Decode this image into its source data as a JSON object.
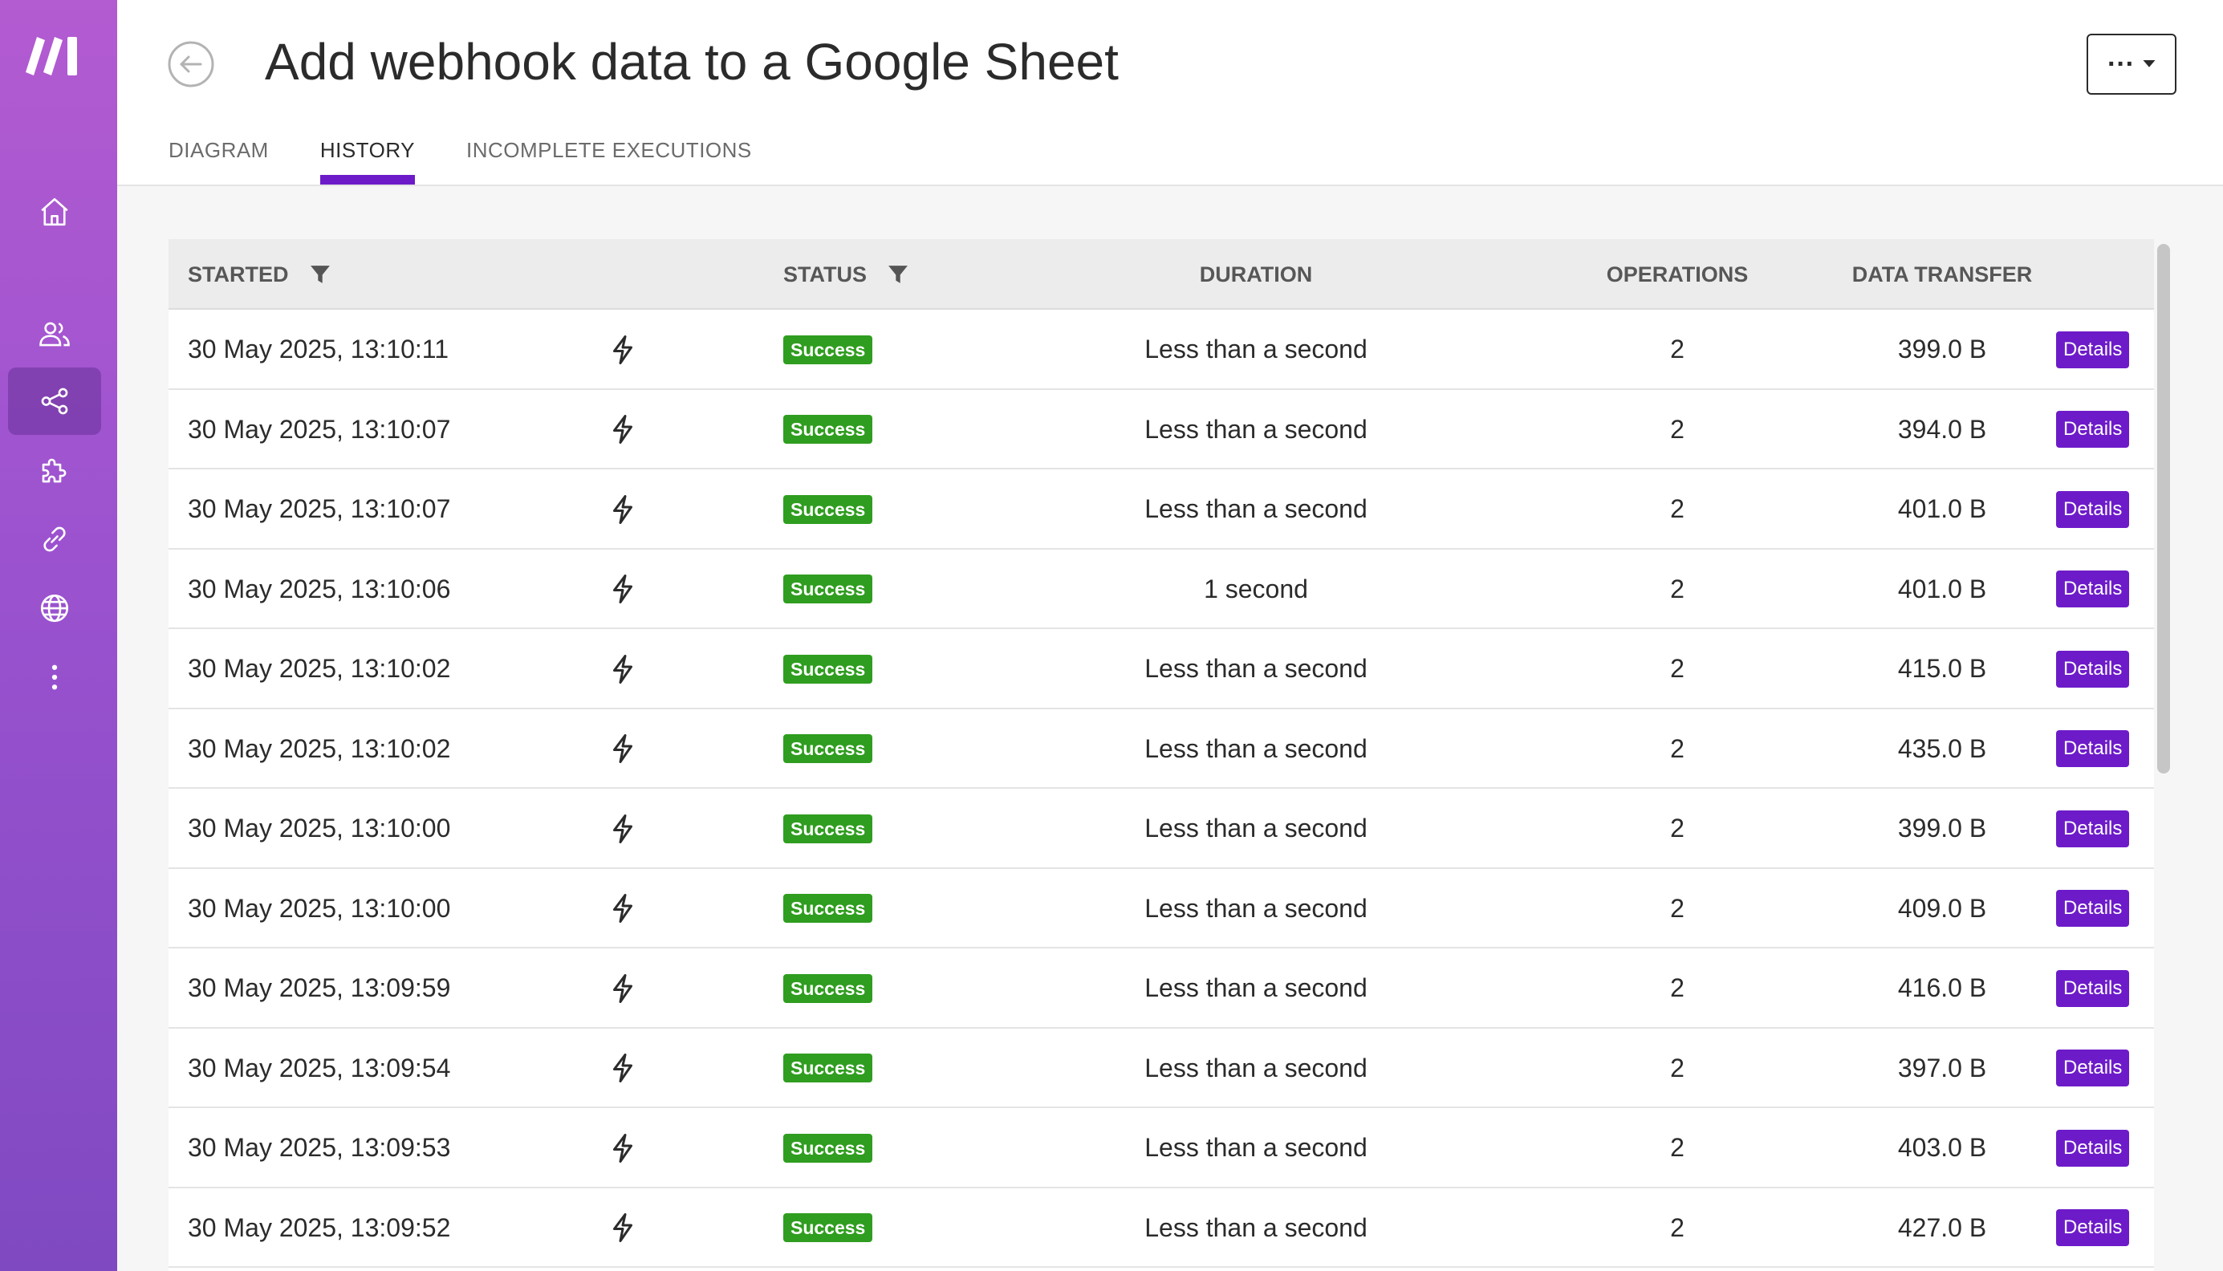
{
  "header": {
    "title": "Add webhook data to a Google Sheet",
    "more_label": "···"
  },
  "tabs": [
    {
      "label": "DIAGRAM"
    },
    {
      "label": "HISTORY"
    },
    {
      "label": "INCOMPLETE EXECUTIONS"
    }
  ],
  "active_tab": "HISTORY",
  "colors": {
    "accent": "#6d1bc9",
    "success": "#2f9d1f",
    "sidebar_top": "#b35bd1",
    "sidebar_bottom": "#7f49c2"
  },
  "sidebar": {
    "items": [
      {
        "icon": "home-icon"
      },
      {
        "icon": "team-icon"
      },
      {
        "icon": "share-scenarios-icon",
        "active": true
      },
      {
        "icon": "puzzle-icon"
      },
      {
        "icon": "link-icon"
      },
      {
        "icon": "globe-icon"
      },
      {
        "icon": "more-vertical-icon"
      }
    ]
  },
  "table": {
    "columns": {
      "started": "STARTED",
      "status": "STATUS",
      "duration": "DURATION",
      "operations": "OPERATIONS",
      "data_transfer": "DATA TRANSFER"
    },
    "rows": [
      {
        "started": "30 May 2025, 13:10:11",
        "status": "Success",
        "duration": "Less than a second",
        "operations": "2",
        "data_transfer": "399.0 B",
        "details": "Details"
      },
      {
        "started": "30 May 2025, 13:10:07",
        "status": "Success",
        "duration": "Less than a second",
        "operations": "2",
        "data_transfer": "394.0 B",
        "details": "Details"
      },
      {
        "started": "30 May 2025, 13:10:07",
        "status": "Success",
        "duration": "Less than a second",
        "operations": "2",
        "data_transfer": "401.0 B",
        "details": "Details"
      },
      {
        "started": "30 May 2025, 13:10:06",
        "status": "Success",
        "duration": "1 second",
        "operations": "2",
        "data_transfer": "401.0 B",
        "details": "Details"
      },
      {
        "started": "30 May 2025, 13:10:02",
        "status": "Success",
        "duration": "Less than a second",
        "operations": "2",
        "data_transfer": "415.0 B",
        "details": "Details"
      },
      {
        "started": "30 May 2025, 13:10:02",
        "status": "Success",
        "duration": "Less than a second",
        "operations": "2",
        "data_transfer": "435.0 B",
        "details": "Details"
      },
      {
        "started": "30 May 2025, 13:10:00",
        "status": "Success",
        "duration": "Less than a second",
        "operations": "2",
        "data_transfer": "399.0 B",
        "details": "Details"
      },
      {
        "started": "30 May 2025, 13:10:00",
        "status": "Success",
        "duration": "Less than a second",
        "operations": "2",
        "data_transfer": "409.0 B",
        "details": "Details"
      },
      {
        "started": "30 May 2025, 13:09:59",
        "status": "Success",
        "duration": "Less than a second",
        "operations": "2",
        "data_transfer": "416.0 B",
        "details": "Details"
      },
      {
        "started": "30 May 2025, 13:09:54",
        "status": "Success",
        "duration": "Less than a second",
        "operations": "2",
        "data_transfer": "397.0 B",
        "details": "Details"
      },
      {
        "started": "30 May 2025, 13:09:53",
        "status": "Success",
        "duration": "Less than a second",
        "operations": "2",
        "data_transfer": "403.0 B",
        "details": "Details"
      },
      {
        "started": "30 May 2025, 13:09:52",
        "status": "Success",
        "duration": "Less than a second",
        "operations": "2",
        "data_transfer": "427.0 B",
        "details": "Details"
      }
    ]
  }
}
